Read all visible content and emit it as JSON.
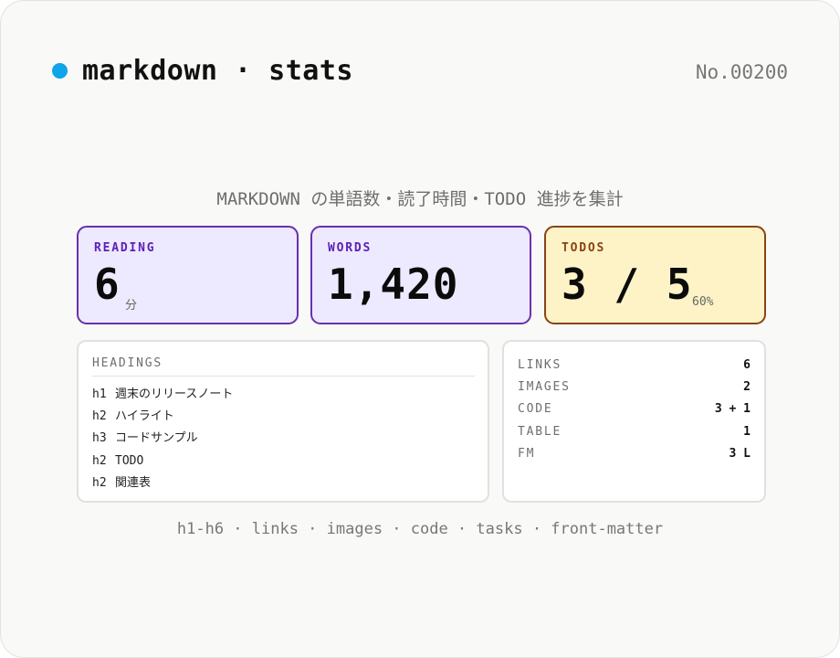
{
  "header": {
    "title": "markdown · stats",
    "doc_number": "No.00200",
    "accent_color": "#0ea5e9"
  },
  "subtitle": "MARKDOWN の単語数・読了時間・TODO 進捗を集計",
  "stats": {
    "reading": {
      "label": "READING",
      "value": "6",
      "unit": "分"
    },
    "words": {
      "label": "WORDS",
      "value": "1,420"
    },
    "todos": {
      "label": "TODOS",
      "value": "3 / 5",
      "percent": "60%",
      "done": 3,
      "total": 5
    }
  },
  "headings_panel": {
    "title": "HEADINGS",
    "items": [
      {
        "level": "h1",
        "text": "週末のリリースノート"
      },
      {
        "level": "h2",
        "text": "ハイライト"
      },
      {
        "level": "h3",
        "text": "コードサンプル"
      },
      {
        "level": "h2",
        "text": "TODO"
      },
      {
        "level": "h2",
        "text": "関連表"
      }
    ]
  },
  "counts_panel": {
    "rows": [
      {
        "label": "LINKS",
        "value": "6"
      },
      {
        "label": "IMAGES",
        "value": "2"
      },
      {
        "label": "CODE",
        "value": "3 + 1"
      },
      {
        "label": "TABLE",
        "value": "1"
      },
      {
        "label": "FM",
        "value": "3 L"
      }
    ]
  },
  "footer": "h1-h6 · links · images · code · tasks · front-matter",
  "colors": {
    "purple_border": "#6b2fb0",
    "purple_fill": "#ede9fe",
    "amber_border": "#8a4315",
    "amber_fill": "#fdf3c6"
  }
}
